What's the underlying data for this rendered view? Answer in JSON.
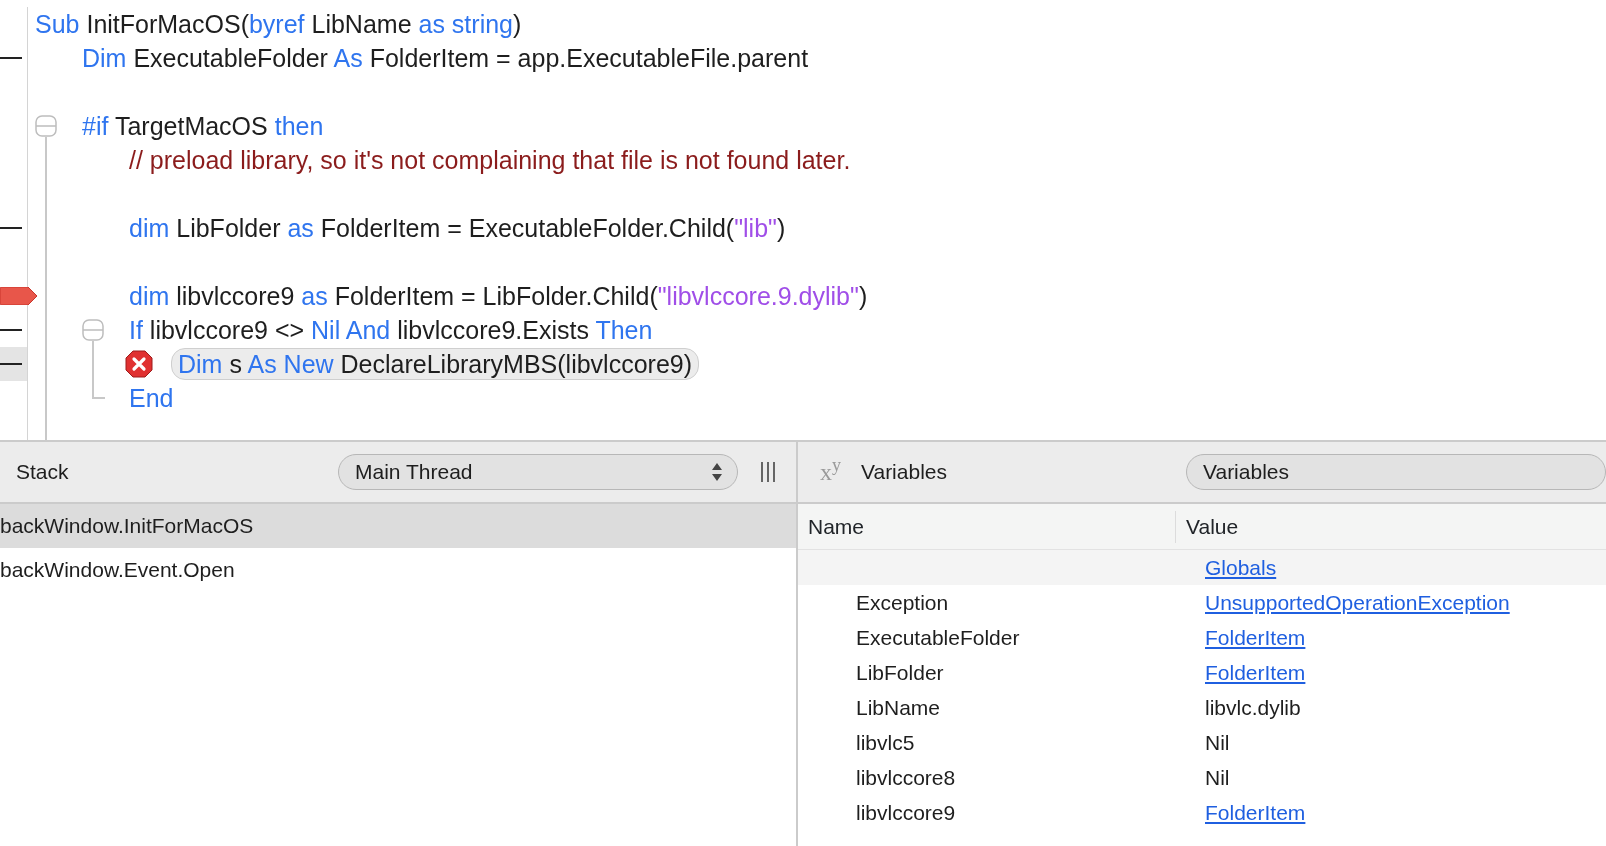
{
  "code": {
    "lines": [
      {
        "kind": "code",
        "executable": false,
        "breakpoint": false,
        "current": false,
        "error": false,
        "tokens": [
          {
            "kind": "keyword",
            "text": "Sub"
          },
          {
            "kind": "plain",
            "text": " InitForMacOS("
          },
          {
            "kind": "keyword",
            "text": "byref"
          },
          {
            "kind": "plain",
            "text": " LibName "
          },
          {
            "kind": "keyword",
            "text": "as string"
          },
          {
            "kind": "plain",
            "text": ")"
          }
        ],
        "children": [
          {
            "kind": "code",
            "executable": true,
            "breakpoint": false,
            "current": false,
            "error": false,
            "tokens": [
              {
                "kind": "keyword",
                "text": "Dim"
              },
              {
                "kind": "plain",
                "text": " ExecutableFolder "
              },
              {
                "kind": "keyword",
                "text": "As"
              },
              {
                "kind": "plain",
                "text": " FolderItem = app.ExecutableFile.parent"
              }
            ]
          },
          {
            "kind": "blank"
          },
          {
            "kind": "code",
            "executable": false,
            "breakpoint": false,
            "current": false,
            "error": false,
            "expanded": true,
            "tokens": [
              {
                "kind": "keyword",
                "text": "#if"
              },
              {
                "kind": "plain",
                "text": " TargetMacOS "
              },
              {
                "kind": "keyword",
                "text": "then"
              }
            ],
            "children": [
              {
                "kind": "code",
                "executable": false,
                "breakpoint": false,
                "current": false,
                "error": false,
                "tokens": [
                  {
                    "kind": "comment",
                    "text": "// preload library, so it's not complaining that file is not found later."
                  }
                ]
              },
              {
                "kind": "blank"
              },
              {
                "kind": "code",
                "executable": true,
                "breakpoint": false,
                "current": false,
                "error": false,
                "tokens": [
                  {
                    "kind": "keyword",
                    "text": "dim"
                  },
                  {
                    "kind": "plain",
                    "text": " LibFolder "
                  },
                  {
                    "kind": "keyword",
                    "text": "as"
                  },
                  {
                    "kind": "plain",
                    "text": " FolderItem = ExecutableFolder.Child("
                  },
                  {
                    "kind": "string",
                    "text": "\"lib\""
                  },
                  {
                    "kind": "plain",
                    "text": ")"
                  }
                ]
              },
              {
                "kind": "blank"
              },
              {
                "kind": "code",
                "executable": true,
                "breakpoint": true,
                "current": false,
                "error": false,
                "tokens": [
                  {
                    "kind": "keyword",
                    "text": "dim"
                  },
                  {
                    "kind": "plain",
                    "text": " libvlccore9 "
                  },
                  {
                    "kind": "keyword",
                    "text": "as"
                  },
                  {
                    "kind": "plain",
                    "text": " FolderItem = LibFolder.Child("
                  },
                  {
                    "kind": "string",
                    "text": "\"libvlccore.9.dylib\""
                  },
                  {
                    "kind": "plain",
                    "text": ")"
                  }
                ]
              },
              {
                "kind": "code",
                "executable": true,
                "breakpoint": false,
                "current": false,
                "error": false,
                "expanded": true,
                "tokens": [
                  {
                    "kind": "keyword",
                    "text": "If"
                  },
                  {
                    "kind": "plain",
                    "text": " libvlccore9 <> "
                  },
                  {
                    "kind": "keyword",
                    "text": "Nil And"
                  },
                  {
                    "kind": "plain",
                    "text": " libvlccore9.Exists "
                  },
                  {
                    "kind": "keyword",
                    "text": "Then"
                  }
                ],
                "children": [
                  {
                    "kind": "code",
                    "executable": true,
                    "breakpoint": false,
                    "current": true,
                    "error": true,
                    "tokens": [
                      {
                        "kind": "keyword",
                        "text": "Dim"
                      },
                      {
                        "kind": "plain",
                        "text": " s "
                      },
                      {
                        "kind": "keyword",
                        "text": "As New"
                      },
                      {
                        "kind": "plain",
                        "text": " DeclareLibraryMBS(libvlccore9)"
                      }
                    ]
                  }
                ]
              },
              {
                "kind": "code",
                "executable": false,
                "breakpoint": false,
                "current": false,
                "error": false,
                "tokens": [
                  {
                    "kind": "keyword",
                    "text": "End"
                  }
                ]
              }
            ]
          }
        ]
      }
    ]
  },
  "stack": {
    "title": "Stack",
    "thread_select": "Main Thread",
    "frames": [
      {
        "text": "backWindow.InitForMacOS",
        "selected": true
      },
      {
        "text": "backWindow.Event.Open",
        "selected": false
      }
    ]
  },
  "variables": {
    "icon": "x$^{y}$",
    "title": "Variables",
    "scope_select": "Variables",
    "columns": [
      "Name",
      "Value"
    ],
    "rows": [
      {
        "kind": "group",
        "value": "Globals",
        "link": true
      },
      {
        "kind": "item",
        "name": "Exception",
        "value": "UnsupportedOperationException",
        "link": true
      },
      {
        "kind": "item",
        "name": "ExecutableFolder",
        "value": "FolderItem",
        "link": true
      },
      {
        "kind": "item",
        "name": "LibFolder",
        "value": "FolderItem",
        "link": true
      },
      {
        "kind": "item",
        "name": "LibName",
        "value": "libvlc.dylib",
        "link": false
      },
      {
        "kind": "item",
        "name": "libvlc5",
        "value": "Nil",
        "link": false
      },
      {
        "kind": "item",
        "name": "libvlccore8",
        "value": "Nil",
        "link": false
      },
      {
        "kind": "item",
        "name": "libvlccore9",
        "value": "FolderItem",
        "link": true
      }
    ]
  }
}
